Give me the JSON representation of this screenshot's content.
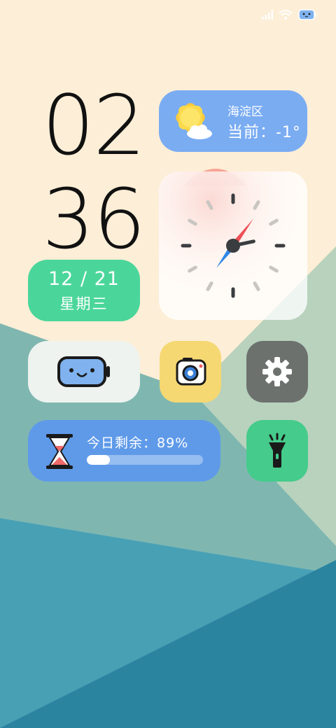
{
  "status_bar": {
    "icons": [
      "signal-icon",
      "wifi-icon",
      "battery-robot-icon"
    ]
  },
  "clock": {
    "hours": "02",
    "minutes": "36"
  },
  "date": {
    "date_text": "12 / 21",
    "weekday": "星期三"
  },
  "weather": {
    "location": "海淀区",
    "current": "当前：-1°",
    "icon": "sun-cloud-icon"
  },
  "analog_clock": {
    "hour": 2,
    "minute": 36
  },
  "apps": [
    {
      "name": "battery-robot",
      "icon": "robot-battery-icon",
      "color": "#eef2ee"
    },
    {
      "name": "camera",
      "icon": "camera-icon",
      "color": "#f5d872"
    },
    {
      "name": "settings",
      "icon": "gear-icon",
      "color": "#6c716e"
    },
    {
      "name": "flashlight",
      "icon": "flashlight-icon",
      "color": "#45cb8b"
    }
  ],
  "day_remaining": {
    "label": "今日剩余：",
    "percent_text": "89%",
    "progress": 0.2,
    "icon": "hourglass-icon"
  },
  "colors": {
    "background": "#fdeed7",
    "date_widget": "#4ad69a",
    "weather_widget": "#7aacf2",
    "timer_widget": "#5f9ae9"
  }
}
